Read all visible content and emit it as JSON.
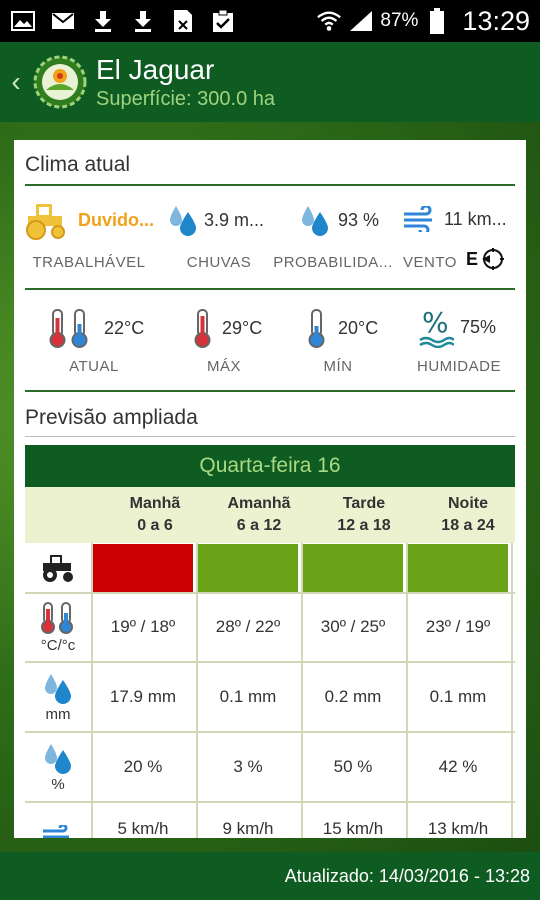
{
  "status_bar": {
    "battery_pct": "87%",
    "time": "13:29",
    "icons": [
      "image-icon",
      "mail-icon",
      "download-icon",
      "download-icon",
      "sim-icon",
      "clipboard-icon",
      "wifi-icon",
      "signal-icon",
      "battery-icon"
    ]
  },
  "header": {
    "title": "El Jaguar",
    "subtitle": "Superfície: 300.0 ha"
  },
  "current": {
    "section_title": "Clima atual",
    "metrics_row1": [
      {
        "value": "Duvido...",
        "label": "TRABALHÁVEL",
        "icon": "tractor-icon"
      },
      {
        "value": "3.9 m...",
        "label": "CHUVAS",
        "icon": "rain-drops-icon"
      },
      {
        "value": "93 %",
        "label": "PROBABILIDA...",
        "icon": "rain-drops-icon"
      },
      {
        "value": "11 km...",
        "label": "VENTO",
        "icon": "wind-icon",
        "direction": "E"
      }
    ],
    "metrics_row2": [
      {
        "value": "22°C",
        "label": "ATUAL",
        "icon": "thermometer-icon"
      },
      {
        "value": "29°C",
        "label": "MÁX",
        "icon": "thermometer-hot-icon"
      },
      {
        "value": "20°C",
        "label": "MÍN",
        "icon": "thermometer-cold-icon"
      },
      {
        "value": "75%",
        "label": "HUMIDADE",
        "icon": "humidity-icon"
      }
    ]
  },
  "forecast": {
    "section_title": "Previsão ampliada",
    "day": "Quarta-feira 16",
    "periods": [
      {
        "name": "Manhã",
        "range": "0 a 6"
      },
      {
        "name": "Amanhã",
        "range": "6 a 12"
      },
      {
        "name": "Tarde",
        "range": "12 a 18"
      },
      {
        "name": "Noite",
        "range": "18 a 24"
      }
    ],
    "workability_colors": [
      "#cc0000",
      "#6aa318",
      "#6aa318",
      "#6aa318"
    ],
    "rows": {
      "temperature": {
        "unit": "°C/°c",
        "values": [
          "19º / 18º",
          "28º / 22º",
          "30º / 25º",
          "23º / 19º"
        ]
      },
      "rain": {
        "unit": "mm",
        "values": [
          "17.9 mm",
          "0.1 mm",
          "0.2 mm",
          "0.1 mm"
        ]
      },
      "probability": {
        "unit": "%",
        "values": [
          "20 %",
          "3 %",
          "50 %",
          "42 %"
        ]
      },
      "wind": {
        "values": [
          "5 km/h",
          "9 km/h",
          "15 km/h",
          "13 km/h"
        ]
      }
    }
  },
  "footer": {
    "updated": "Atualizado: 14/03/2016 - 13:28"
  }
}
